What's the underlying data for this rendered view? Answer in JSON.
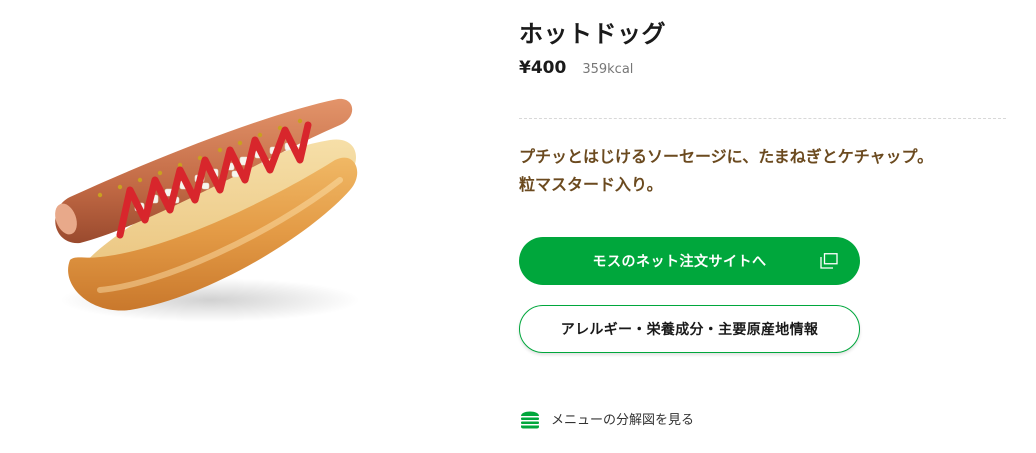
{
  "product": {
    "name": "ホットドッグ",
    "price": "¥400",
    "calories": "359kcal",
    "description_line1": "プチッとはじけるソーセージに、たまねぎとケチャップ。",
    "description_line2": "粒マスタード入り。",
    "image_icon": "hotdog-image"
  },
  "actions": {
    "order_label": "モスのネット注文サイトへ",
    "order_icon": "external-window-icon",
    "allergy_label": "アレルギー・栄養成分・主要原産地情報",
    "breakdown_label": "メニューの分解図を見る",
    "breakdown_icon": "burger-icon"
  },
  "colors": {
    "accent_green": "#00a73c",
    "description_brown": "#6b4a1f"
  }
}
